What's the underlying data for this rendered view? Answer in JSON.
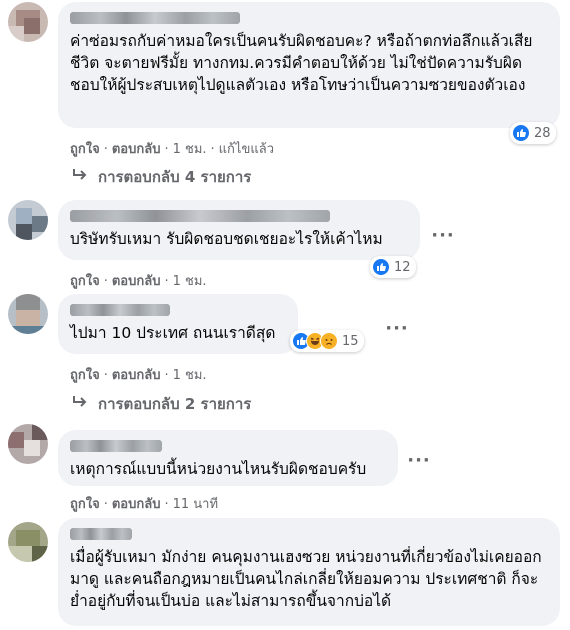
{
  "comments": [
    {
      "text": "ค่าซ่อมรถกับค่าหมอใครเป็นคนรับผิดชอบคะ? หรือถ้าตกท่อลึกแล้วเสียชีวิต จะตายฟรีมั้ย ทางกทม.ควรมีคำตอบให้ด้วย ไม่ใช่ปัดความรับผิดชอบให้ผู้ประสบเหตุไปดูแลตัวเอง หรือโทษว่าเป็นความซวยของตัวเอง",
      "like_label": "ถูกใจ",
      "reply_label": "ตอบกลับ",
      "time": "1 ชม.",
      "edited": "แก้ไขแล้ว",
      "reaction_count": "28",
      "replies_label": "การตอบกลับ 4 รายการ"
    },
    {
      "text": "บริษัทรับเหมา รับผิดชอบชดเชยอะไรให้เค้าไหม",
      "like_label": "ถูกใจ",
      "reply_label": "ตอบกลับ",
      "time": "1 ชม.",
      "reaction_count": "12"
    },
    {
      "text": "ไปมา 10 ประเทศ ถนนเราดีสุด",
      "like_label": "ถูกใจ",
      "reply_label": "ตอบกลับ",
      "time": "1 ชม.",
      "reaction_count": "15",
      "replies_label": "การตอบกลับ 2 รายการ"
    },
    {
      "text": "เหตุการณ์แบบนี้หน่วยงานไหนรับผิดชอบครับ",
      "like_label": "ถูกใจ",
      "reply_label": "ตอบกลับ",
      "time": "11 นาที"
    },
    {
      "text": "เมื่อผู้รับเหมา มักง่าย คนคุมงานเฮงซวย หน่วยงานที่เกี่ยวข้องไม่เคยออกมาดู และคนถือกฎหมายเป็นคนไกล่เกลี่ยให้ยอมความ ประเทศชาติ ก็จะย่ำอยู่กับที่จนเป็นบ่อ และไม่สามารถขึ้นจากบ่อได้"
    }
  ],
  "icons": {
    "more": "more-options-icon",
    "like": "like-reaction-icon",
    "haha": "haha-reaction-icon",
    "sad": "sad-reaction-icon",
    "reply_arrow": "reply-arrow-icon"
  },
  "colors": {
    "bubble": "#f0f2f5",
    "meta": "#65676b",
    "like_blue": "#1877f2",
    "emoji_yellow": "#f7b125"
  }
}
